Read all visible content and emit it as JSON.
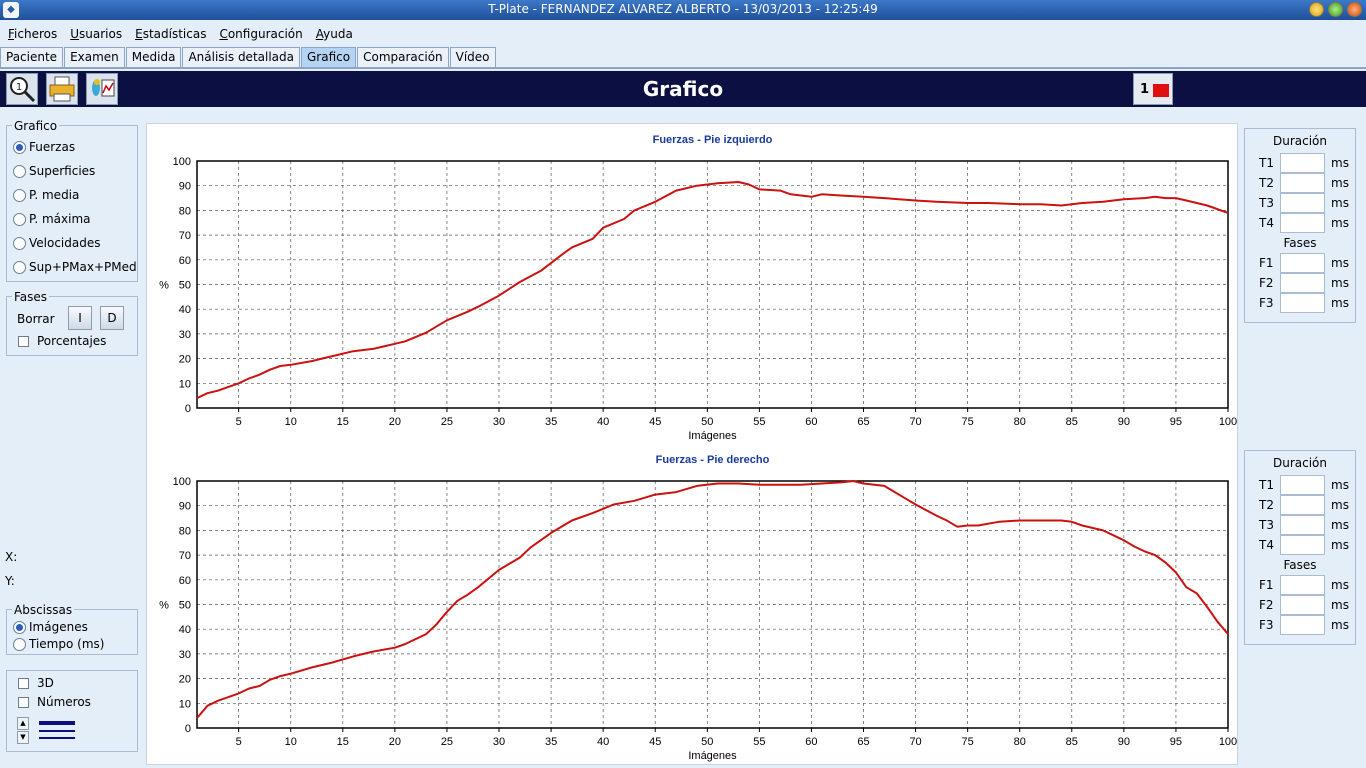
{
  "window": {
    "title": "T-Plate - FERNANDEZ ALVAREZ ALBERTO - 13/03/2013 - 12:25:49"
  },
  "menu": [
    {
      "label": "Ficheros"
    },
    {
      "label": "Usuarios"
    },
    {
      "label": "Estadísticas"
    },
    {
      "label": "Configuración"
    },
    {
      "label": "Ayuda"
    }
  ],
  "tabs": [
    {
      "label": "Paciente",
      "active": false
    },
    {
      "label": "Examen",
      "active": false
    },
    {
      "label": "Medida",
      "active": false
    },
    {
      "label": "Análisis detallada",
      "active": false
    },
    {
      "label": "Grafico",
      "active": true
    },
    {
      "label": "Comparación",
      "active": false
    },
    {
      "label": "Vídeo",
      "active": false
    }
  ],
  "header": {
    "title": "Grafico",
    "page_number": "1",
    "tools": [
      "zoom-icon",
      "printer-icon",
      "foot-chart-icon"
    ],
    "accent_color": "#0b0f42",
    "flag_color": "#e01010"
  },
  "grafico_group": {
    "title": "Grafico",
    "options": [
      {
        "label": "Fuerzas",
        "checked": true
      },
      {
        "label": "Superficies",
        "checked": false
      },
      {
        "label": "P. media",
        "checked": false
      },
      {
        "label": "P. máxima",
        "checked": false
      },
      {
        "label": "Velocidades",
        "checked": false
      },
      {
        "label": "Sup+PMax+PMed",
        "checked": false
      }
    ]
  },
  "fases_group": {
    "title": "Fases",
    "borrar_label": "Borrar",
    "izquierdo_button": "I",
    "derecho_button": "D",
    "porcentajes_label": "Porcentajes"
  },
  "coords": {
    "x_label": "X:",
    "y_label": "Y:"
  },
  "abscissas_group": {
    "title": "Abscissas",
    "options": [
      {
        "label": "Imágenes",
        "checked": true
      },
      {
        "label": "Tiempo (ms)",
        "checked": false
      }
    ]
  },
  "display_group": {
    "three_d_label": "3D",
    "numeros_label": "Números"
  },
  "timing_panels": [
    {
      "duracion_title": "Duración",
      "t_rows": [
        {
          "label": "T1",
          "unit": "ms"
        },
        {
          "label": "T2",
          "unit": "ms"
        },
        {
          "label": "T3",
          "unit": "ms"
        },
        {
          "label": "T4",
          "unit": "ms"
        }
      ],
      "fases_title": "Fases",
      "f_rows": [
        {
          "label": "F1",
          "unit": "ms"
        },
        {
          "label": "F2",
          "unit": "ms"
        },
        {
          "label": "F3",
          "unit": "ms"
        }
      ]
    },
    {
      "duracion_title": "Duración",
      "t_rows": [
        {
          "label": "T1",
          "unit": "ms"
        },
        {
          "label": "T2",
          "unit": "ms"
        },
        {
          "label": "T3",
          "unit": "ms"
        },
        {
          "label": "T4",
          "unit": "ms"
        }
      ],
      "fases_title": "Fases",
      "f_rows": [
        {
          "label": "F1",
          "unit": "ms"
        },
        {
          "label": "F2",
          "unit": "ms"
        },
        {
          "label": "F3",
          "unit": "ms"
        }
      ]
    }
  ],
  "chart_data": [
    {
      "type": "line",
      "title": "Fuerzas - Pie izquierdo",
      "xlabel": "Imágenes",
      "ylabel": "%",
      "xlim": [
        1,
        100
      ],
      "ylim": [
        0,
        100
      ],
      "xticks": [
        5,
        10,
        15,
        20,
        25,
        30,
        35,
        40,
        45,
        50,
        55,
        60,
        65,
        70,
        75,
        80,
        85,
        90,
        95,
        100
      ],
      "yticks": [
        0,
        10,
        20,
        30,
        40,
        50,
        60,
        70,
        80,
        90,
        100
      ],
      "grid": true,
      "line_color": "#cc1111",
      "x": [
        1,
        2,
        3,
        5,
        6,
        7,
        8,
        9,
        10,
        12,
        14,
        16,
        18,
        20,
        21,
        23,
        25,
        27,
        28,
        30,
        32,
        34,
        36,
        37,
        39,
        40,
        42,
        43,
        45,
        47,
        49,
        51,
        53,
        54,
        55,
        57,
        58,
        60,
        61,
        63,
        65,
        67,
        70,
        72,
        75,
        77,
        80,
        82,
        84,
        86,
        88,
        90,
        92,
        93,
        94,
        95,
        96,
        98,
        100
      ],
      "y": [
        4,
        6,
        7,
        10,
        12,
        13.5,
        15.5,
        17,
        17.5,
        19,
        21,
        23,
        24,
        26,
        27,
        30.5,
        35.5,
        39,
        41,
        45.5,
        51,
        55.5,
        62,
        65,
        68.5,
        73,
        76.5,
        80,
        83.5,
        88,
        90,
        91,
        91.5,
        90.5,
        88.5,
        88,
        86.5,
        85.5,
        86.5,
        86,
        85.5,
        85,
        84,
        83.5,
        83,
        83,
        82.5,
        82.5,
        82,
        83,
        83.5,
        84.5,
        85,
        85.5,
        85,
        85,
        84,
        82,
        79
      ]
    },
    {
      "type": "line",
      "title": "Fuerzas - Pie derecho",
      "xlabel": "Imágenes",
      "ylabel": "%",
      "xlim": [
        1,
        100
      ],
      "ylim": [
        0,
        100
      ],
      "xticks": [
        5,
        10,
        15,
        20,
        25,
        30,
        35,
        40,
        45,
        50,
        55,
        60,
        65,
        70,
        75,
        80,
        85,
        90,
        95,
        100
      ],
      "yticks": [
        0,
        10,
        20,
        30,
        40,
        50,
        60,
        70,
        80,
        90,
        100
      ],
      "grid": true,
      "line_color": "#cc1111",
      "x": [
        1,
        2,
        3,
        5,
        6,
        7,
        8,
        9,
        10,
        12,
        14,
        16,
        18,
        20,
        21,
        23,
        24,
        25,
        26,
        27,
        28,
        30,
        32,
        33,
        35,
        37,
        39,
        41,
        43,
        45,
        47,
        49,
        51,
        53,
        55,
        57,
        59,
        61,
        63,
        64,
        65,
        67,
        69,
        70,
        72,
        73,
        74,
        75,
        76,
        78,
        80,
        82,
        84,
        85,
        86,
        88,
        90,
        91,
        92,
        93,
        94,
        95,
        96,
        97,
        98,
        99,
        100
      ],
      "y": [
        4,
        9,
        11,
        14,
        16,
        17,
        19.5,
        21,
        22,
        24.5,
        26.5,
        29,
        31,
        32.5,
        34,
        38,
        42,
        47,
        51.5,
        54,
        57,
        64,
        69,
        73,
        79,
        84,
        87,
        90.5,
        92,
        94.5,
        95.5,
        98,
        99,
        99,
        98.5,
        98.5,
        98.5,
        99,
        99.5,
        100,
        99,
        98,
        93,
        90.5,
        86,
        84,
        81.5,
        82,
        82,
        83.5,
        84,
        84,
        84,
        83.5,
        82,
        80,
        76,
        73.5,
        71.5,
        70,
        67,
        63,
        57,
        54.5,
        49,
        43,
        38
      ]
    }
  ]
}
